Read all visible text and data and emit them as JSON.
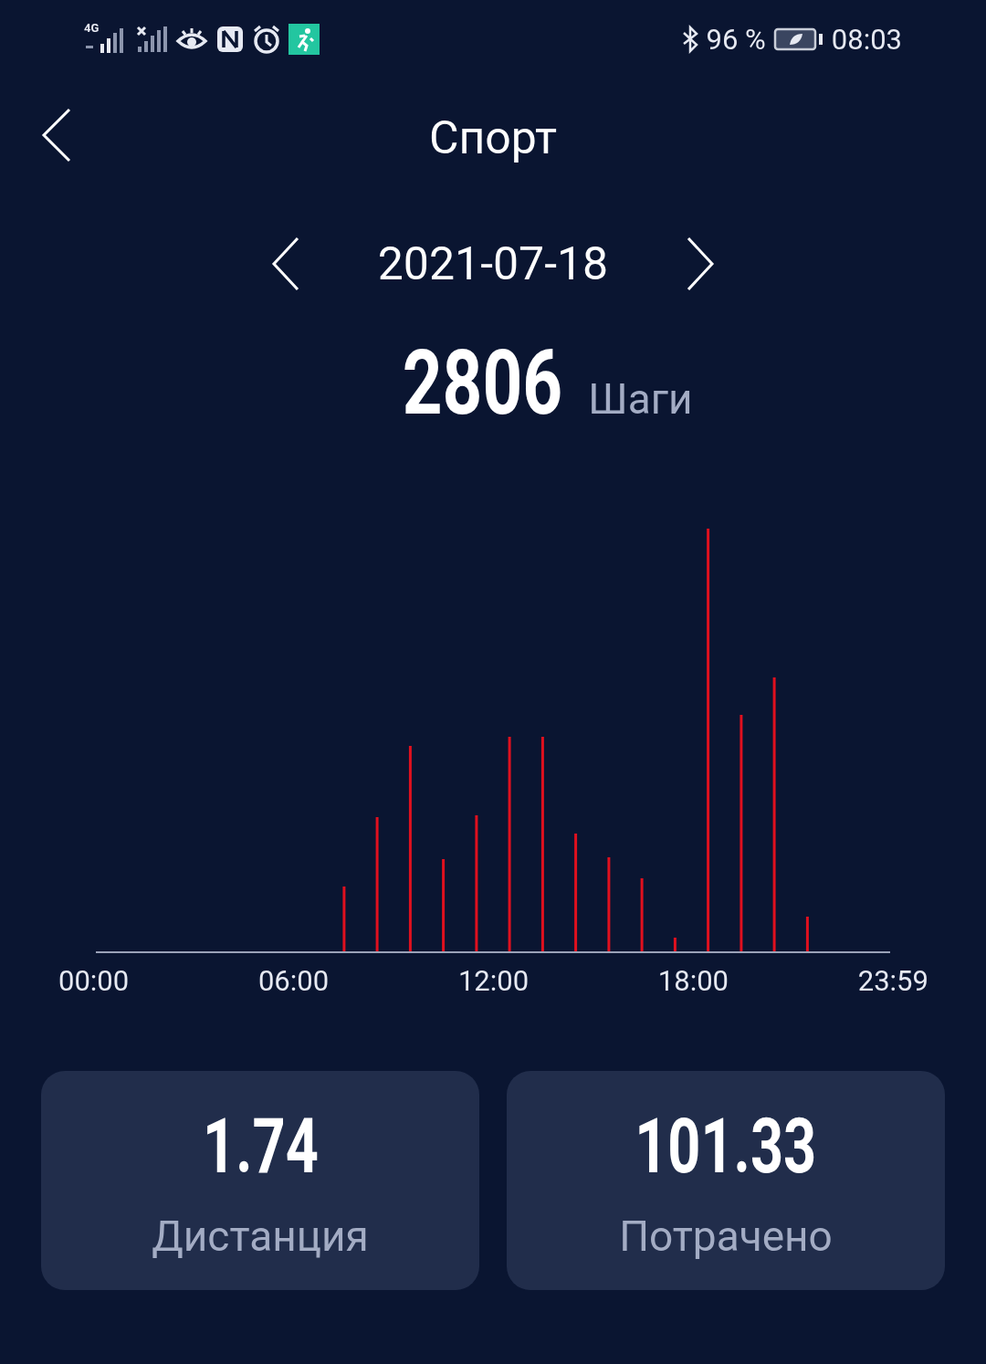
{
  "status_bar": {
    "network": "4G",
    "battery": "96 %",
    "time": "08:03"
  },
  "header": {
    "title": "Спорт"
  },
  "date_nav": {
    "date": "2021-07-18"
  },
  "steps": {
    "value": "2806",
    "unit": "Шаги"
  },
  "chart": {
    "x_labels": [
      "00:00",
      "06:00",
      "12:00",
      "18:00",
      "23:59"
    ]
  },
  "cards": [
    {
      "value": "1.74",
      "label": "Дистанция"
    },
    {
      "value": "101.33",
      "label": "Потрачено"
    }
  ]
}
